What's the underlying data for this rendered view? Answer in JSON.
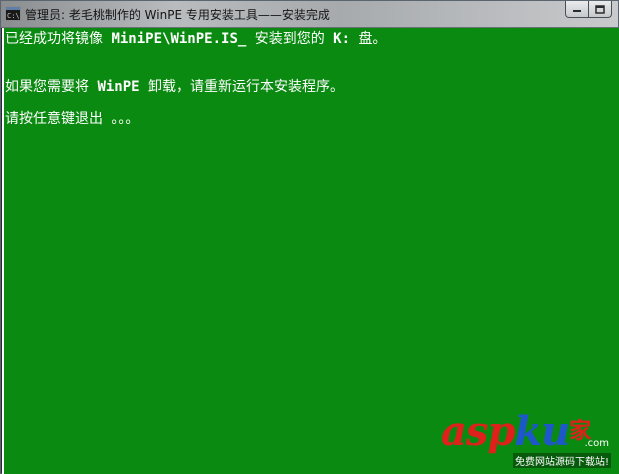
{
  "window": {
    "title": "管理员: 老毛桃制作的 WinPE 专用安装工具——安装完成",
    "buttons": {
      "minimize": "minimize",
      "maximize": "maximize"
    }
  },
  "console": {
    "background": "#0b8a12",
    "text_color": "#ffffff",
    "lines": [
      {
        "before": "已经成功将镜像 ",
        "bold": "MiniPE\\WinPE.IS_",
        "after": " 安装到您的 ",
        "bold2": "K:",
        "after2": " 盘。"
      },
      {
        "before": "如果您需要将 ",
        "bold": "WinPE",
        "after": " 卸载，请重新运行本安装程序。"
      },
      {
        "text": "请按任意键退出 。。。"
      }
    ]
  },
  "watermark": {
    "logo_asp": "asp",
    "logo_ku": "ku",
    "logo_jia": "家",
    "com": ".com",
    "slogan": "免费网站源码下载站!"
  }
}
